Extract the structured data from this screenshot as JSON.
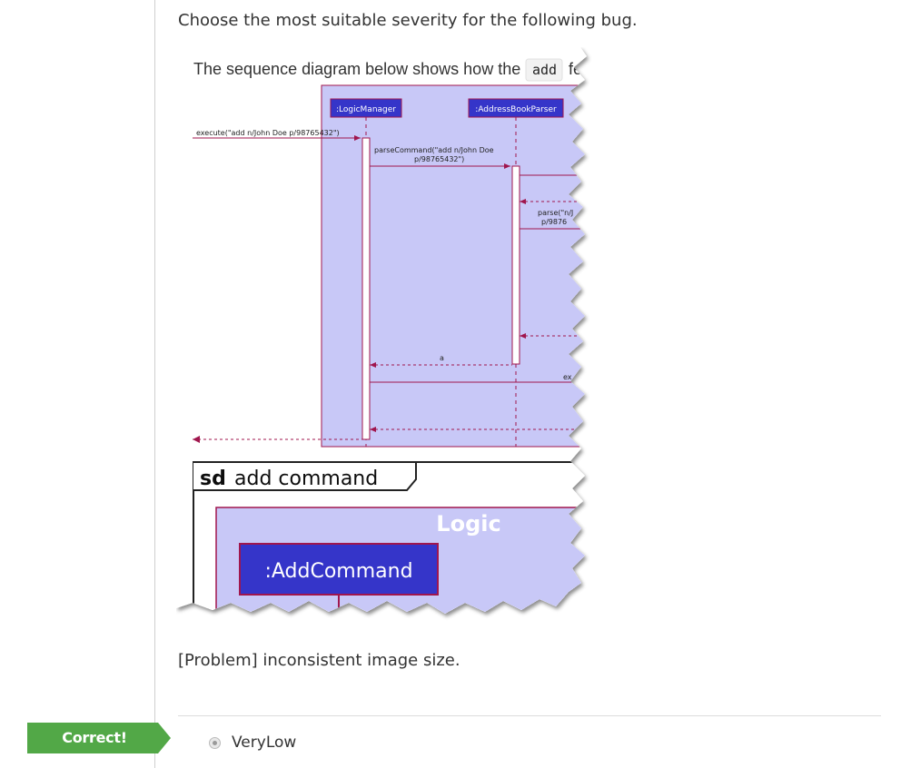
{
  "question": "Choose the most suitable severity for the following bug.",
  "snippet": {
    "intro_prefix": "The sequence diagram below shows how the",
    "intro_code": "add",
    "intro_suffix": "fe",
    "logic_manager": ":LogicManager",
    "address_book_parser": ":AddressBookParser",
    "execute_msg": "execute(\"add n/John Doe p/98765432\")",
    "parse_command_line1": "parseCommand(\"add n/John Doe",
    "parse_command_line2": "p/98765432\")",
    "parse_line1": "parse(\"n/J",
    "parse_line2": "p/9876",
    "return_a": "a",
    "ex_label": "ex",
    "sd_keyword": "sd",
    "sd_title": "add command",
    "logic_label": "Logic",
    "add_command": ":AddCommand"
  },
  "problem": "[Problem] inconsistent image size.",
  "result_badge": "Correct!",
  "options": [
    {
      "label": "VeryLow",
      "selected": true
    }
  ],
  "colors": {
    "badge_green": "#52a847",
    "frame_purple": "#c8c8f7",
    "actor_blue": "#3535c9",
    "border_red": "#a0144e"
  }
}
